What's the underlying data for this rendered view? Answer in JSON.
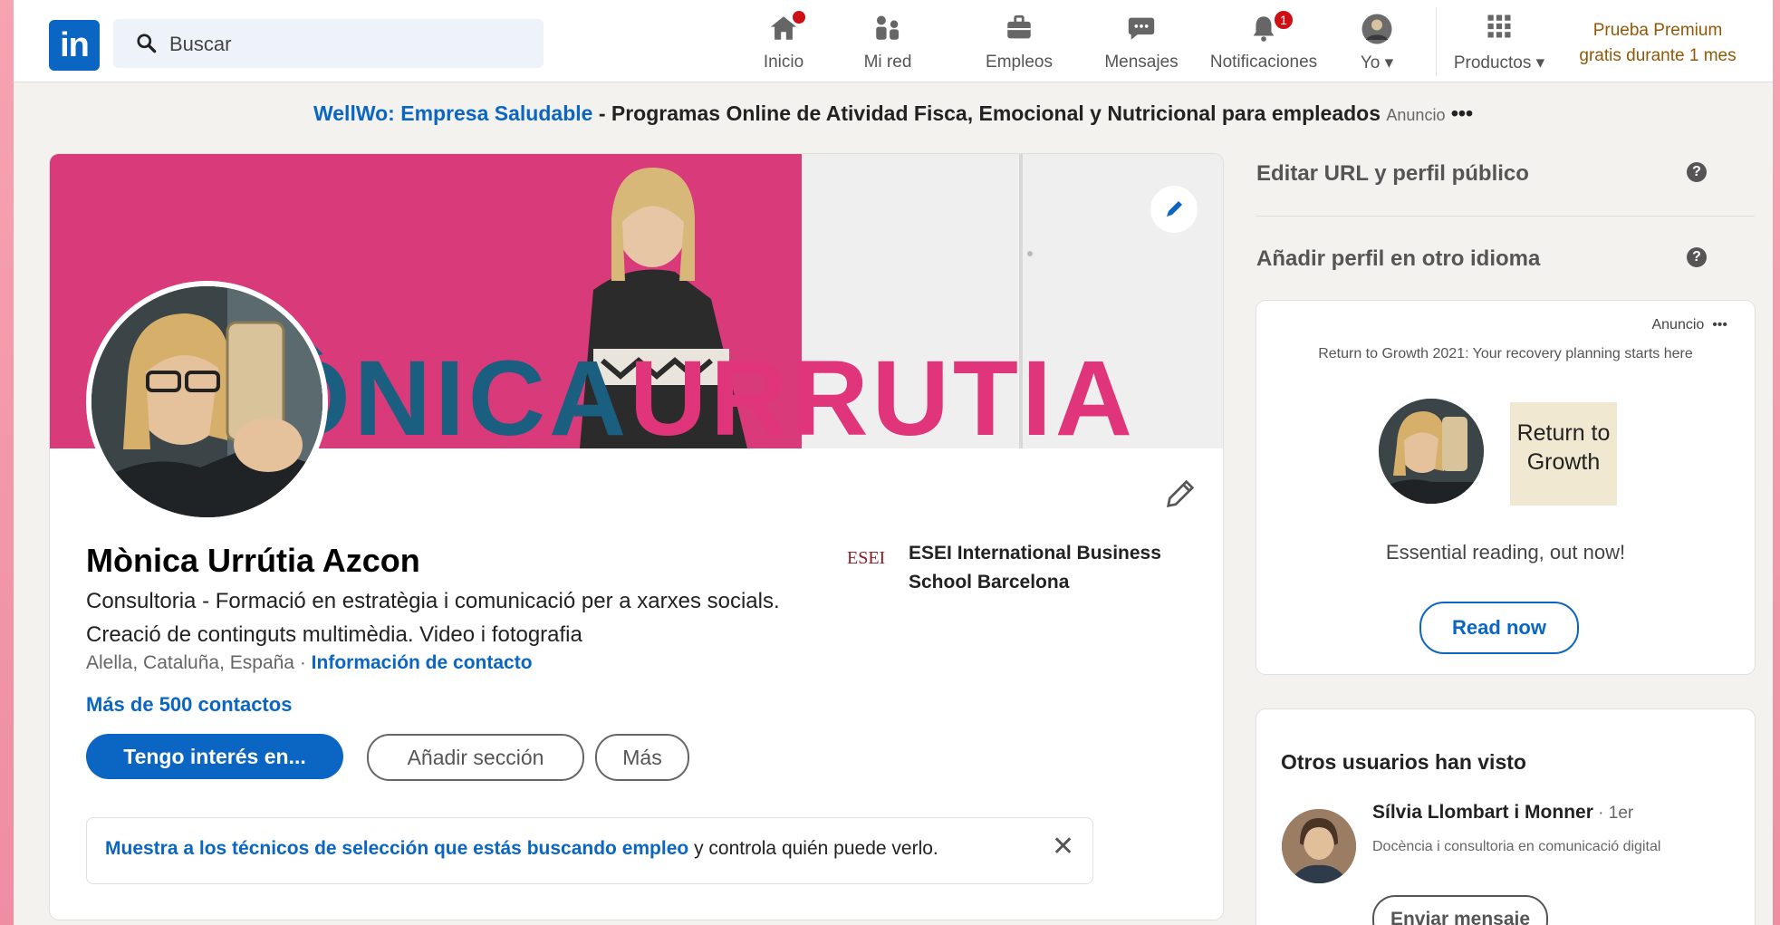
{
  "nav": {
    "search_placeholder": "Buscar",
    "items": [
      {
        "label": "Inicio",
        "icon": "home-icon",
        "badge": ""
      },
      {
        "label": "Mi red",
        "icon": "network-icon",
        "badge": ""
      },
      {
        "label": "Empleos",
        "icon": "briefcase-icon",
        "badge": ""
      },
      {
        "label": "Mensajes",
        "icon": "chat-icon",
        "badge": ""
      },
      {
        "label": "Notificaciones",
        "icon": "bell-icon",
        "badge": "1"
      },
      {
        "label": "Yo",
        "icon": "avatar-icon",
        "badge": ""
      },
      {
        "label": "Productos",
        "icon": "grid-icon",
        "badge": ""
      }
    ],
    "premium_line1": "Prueba Premium",
    "premium_line2": "gratis durante 1 mes"
  },
  "ad_banner": {
    "link": "WellWo: Empresa Saludable",
    "dash": " - ",
    "text": "Programas Online de Atividad Fisca, Emocional y Nutricional para empleados",
    "tag": "Anuncio",
    "more": "•••"
  },
  "profile": {
    "banner_text_blue": "ÒNICA",
    "banner_text_pink": "URRUTIA",
    "name": "Mònica Urrútia Azcon",
    "headline": "Consultoria - Formació en estratègia i comunicació per a xarxes socials. Creació de continguts multimèdia. Video i fotografia",
    "location": "Alella, Cataluña, España",
    "location_sep": " · ",
    "contact_info": "Información de contacto",
    "contacts": "Más de 500 contactos",
    "btn_interest": "Tengo interés en...",
    "btn_add_section": "Añadir sección",
    "btn_more": "Más",
    "school_logo": "ESEI",
    "school": "ESEI International Business School Barcelona",
    "otw_link": "Muestra a los técnicos de selección que estás buscando empleo",
    "otw_text": " y controla quién puede verlo.",
    "otw_close": "✕"
  },
  "right": {
    "edit_url": "Editar URL y perfil público",
    "add_lang": "Añadir perfil en otro idioma",
    "ad": {
      "tag": "Anuncio",
      "more": "•••",
      "promo": "Return to Growth 2021: Your recovery planning starts here",
      "logo_line1": "Return to",
      "logo_line2": "Growth",
      "tagline": "Essential reading, out now!",
      "cta": "Read now"
    },
    "others": {
      "title": "Otros usuarios han visto",
      "person_name": "Sílvia Llombart i Monner",
      "person_degree": " · 1er",
      "person_desc": "Docència i consultoria en comunicació digital",
      "send": "Enviar mensaje"
    }
  },
  "colors": {
    "brand": "#0a66c2",
    "banner_pink": "#e0357a",
    "notif_red": "#cc1016"
  }
}
